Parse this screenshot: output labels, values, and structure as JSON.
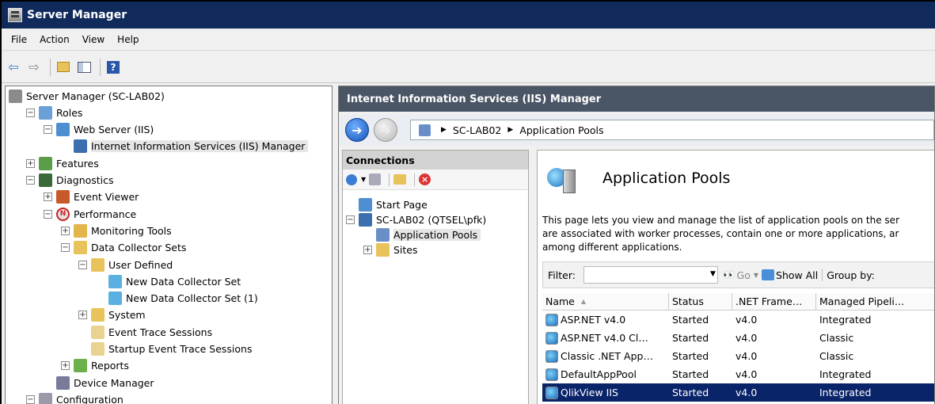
{
  "window": {
    "title": "Server Manager"
  },
  "menu": [
    "File",
    "Action",
    "View",
    "Help"
  ],
  "tree": [
    {
      "label": "Server Manager (SC-LAB02)",
      "level": 0,
      "expander": "",
      "icon": "server-icon"
    },
    {
      "label": "Roles",
      "level": 1,
      "expander": "−",
      "icon": "roles-icon"
    },
    {
      "label": "Web Server (IIS)",
      "level": 2,
      "expander": "−",
      "icon": "web-server-icon"
    },
    {
      "label": "Internet Information Services (IIS) Manager",
      "level": 3,
      "expander": "",
      "icon": "iis-manager-icon",
      "selected": true
    },
    {
      "label": "Features",
      "level": 1,
      "expander": "+",
      "icon": "features-icon"
    },
    {
      "label": "Diagnostics",
      "level": 1,
      "expander": "−",
      "icon": "diagnostics-icon"
    },
    {
      "label": "Event Viewer",
      "level": 2,
      "expander": "+",
      "icon": "event-viewer-icon"
    },
    {
      "label": "Performance",
      "level": 2,
      "expander": "−",
      "icon": "performance-icon"
    },
    {
      "label": "Monitoring Tools",
      "level": 3,
      "expander": "+",
      "icon": "monitoring-tools-icon"
    },
    {
      "label": "Data Collector Sets",
      "level": 3,
      "expander": "−",
      "icon": "folder-icon"
    },
    {
      "label": "User Defined",
      "level": 4,
      "expander": "−",
      "icon": "user-defined-icon"
    },
    {
      "label": "New Data Collector Set",
      "level": 5,
      "expander": "",
      "icon": "collector-running-icon"
    },
    {
      "label": "New Data Collector Set (1)",
      "level": 5,
      "expander": "",
      "icon": "collector-icon"
    },
    {
      "label": "System",
      "level": 4,
      "expander": "+",
      "icon": "system-icon"
    },
    {
      "label": "Event Trace Sessions",
      "level": 4,
      "expander": "",
      "icon": "trace-icon"
    },
    {
      "label": "Startup Event Trace Sessions",
      "level": 4,
      "expander": "",
      "icon": "trace-icon"
    },
    {
      "label": "Reports",
      "level": 3,
      "expander": "+",
      "icon": "reports-icon"
    },
    {
      "label": "Device Manager",
      "level": 2,
      "expander": "",
      "icon": "device-manager-icon"
    },
    {
      "label": "Configuration",
      "level": 1,
      "expander": "−",
      "icon": "configuration-icon"
    }
  ],
  "iis": {
    "header": "Internet Information Services (IIS) Manager",
    "breadcrumb": [
      "SC-LAB02",
      "Application Pools"
    ],
    "connections": {
      "title": "Connections",
      "tree": [
        {
          "label": "Start Page",
          "level": 0,
          "expander": ""
        },
        {
          "label": "SC-LAB02 (QTSEL\\pfk)",
          "level": 0,
          "expander": "−"
        },
        {
          "label": "Application Pools",
          "level": 1,
          "expander": "",
          "selected": true
        },
        {
          "label": "Sites",
          "level": 1,
          "expander": "+"
        }
      ]
    },
    "page_title": "Application Pools",
    "description": [
      "This page lets you view and manage the list of application pools on the ser",
      "are associated with worker processes, contain one or more applications, ar",
      "among different applications."
    ],
    "filter": {
      "label": "Filter:",
      "go": "Go",
      "show_all": "Show All",
      "group_by": "Group by:"
    },
    "columns": [
      "Name",
      "Status",
      ".NET Frame…",
      "Managed Pipeli…"
    ],
    "rows": [
      {
        "name": "ASP.NET v4.0",
        "status": "Started",
        "net": "v4.0",
        "pipeline": "Integrated"
      },
      {
        "name": "ASP.NET v4.0 Cl…",
        "status": "Started",
        "net": "v4.0",
        "pipeline": "Classic"
      },
      {
        "name": "Classic .NET App…",
        "status": "Started",
        "net": "v4.0",
        "pipeline": "Classic"
      },
      {
        "name": "DefaultAppPool",
        "status": "Started",
        "net": "v4.0",
        "pipeline": "Integrated"
      },
      {
        "name": "QlikView IIS",
        "status": "Started",
        "net": "v4.0",
        "pipeline": "Integrated",
        "selected": true
      }
    ]
  }
}
